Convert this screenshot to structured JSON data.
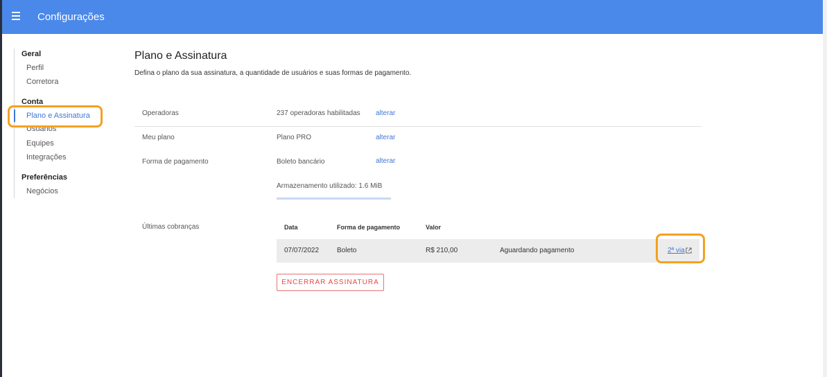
{
  "header": {
    "title": "Configurações",
    "menu_icon": "hamburger-menu-icon"
  },
  "sidebar": {
    "sections": [
      {
        "title": "Geral",
        "items": [
          {
            "label": "Perfil"
          },
          {
            "label": "Corretora"
          }
        ]
      },
      {
        "title": "Conta",
        "items": [
          {
            "label": "Plano e Assinatura",
            "active": true
          },
          {
            "label": "Usuários"
          },
          {
            "label": "Equipes"
          },
          {
            "label": "Integrações"
          }
        ]
      },
      {
        "title": "Preferências",
        "items": [
          {
            "label": "Negócios"
          }
        ]
      }
    ]
  },
  "page": {
    "title": "Plano e Assinatura",
    "description": "Defina o plano da sua assinatura, a quantidade de usuários e suas formas de pagamento."
  },
  "settings": {
    "operadoras": {
      "label": "Operadoras",
      "value": "237 operadoras habilitadas",
      "action": "alterar"
    },
    "plano": {
      "label": "Meu plano",
      "value": "Plano PRO",
      "action": "alterar"
    },
    "pagamento": {
      "label": "Forma de pagamento",
      "value": "Boleto bancário",
      "action": "alterar"
    },
    "storage": {
      "label": "Armazenamento utilizado: 1.6 MiB"
    }
  },
  "billing": {
    "label": "Últimas cobranças",
    "columns": [
      "Data",
      "Forma de pagamento",
      "Valor"
    ],
    "rows": [
      {
        "date": "07/07/2022",
        "method": "Boleto",
        "amount": "R$ 210,00",
        "status": "Aguardando pagamento",
        "action": "2ª via",
        "action_icon": "external-link-icon"
      }
    ]
  },
  "buttons": {
    "cancel": "ENCERRAR ASSINATURA"
  },
  "colors": {
    "topbar": "#4a88ea",
    "accent": "#3f77d6",
    "danger": "#e04848",
    "highlight": "#f5a020"
  }
}
